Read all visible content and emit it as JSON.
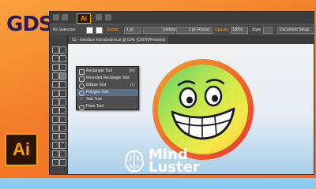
{
  "brand": {
    "name": "GDS."
  },
  "titlebar": {
    "app_badge": "Ai"
  },
  "control_bar": {
    "selection": "No Selection",
    "stroke_label": "Stroke:",
    "stroke_value": "1 pt",
    "profile": "Uniform",
    "brush": "1 pt. Round",
    "opacity_label": "Opacity:",
    "opacity_value": "100%",
    "style_label": "Style:",
    "doc_setup": "Document Setup"
  },
  "document_tab": {
    "title": "01 - Interface Introduction.ai @ 50% (CMYK/Preview)"
  },
  "tool_flyout": {
    "items": [
      {
        "label": "Rectangle Tool",
        "key": "(M)",
        "icon": "rectangle-icon"
      },
      {
        "label": "Rounded Rectangle Tool",
        "key": "",
        "icon": "rounded-rectangle-icon"
      },
      {
        "label": "Ellipse Tool",
        "key": "(L)",
        "icon": "ellipse-icon"
      },
      {
        "label": "Polygon Tool",
        "key": "",
        "icon": "polygon-icon"
      },
      {
        "label": "Star Tool",
        "key": "",
        "icon": "star-icon"
      },
      {
        "label": "Flare Tool",
        "key": "",
        "icon": "flare-icon"
      }
    ],
    "highlighted_index": 3
  },
  "ai_logo": {
    "text": "Ai"
  },
  "watermark": {
    "line1": "Mind",
    "line2": "Luster"
  },
  "colors": {
    "orange_bg": "#f27c2a",
    "gds_purple": "#2d1a5e",
    "ai_orange": "#f5a200",
    "ai_dark": "#2b1500",
    "bottom_bar": "#8ec9ef"
  }
}
